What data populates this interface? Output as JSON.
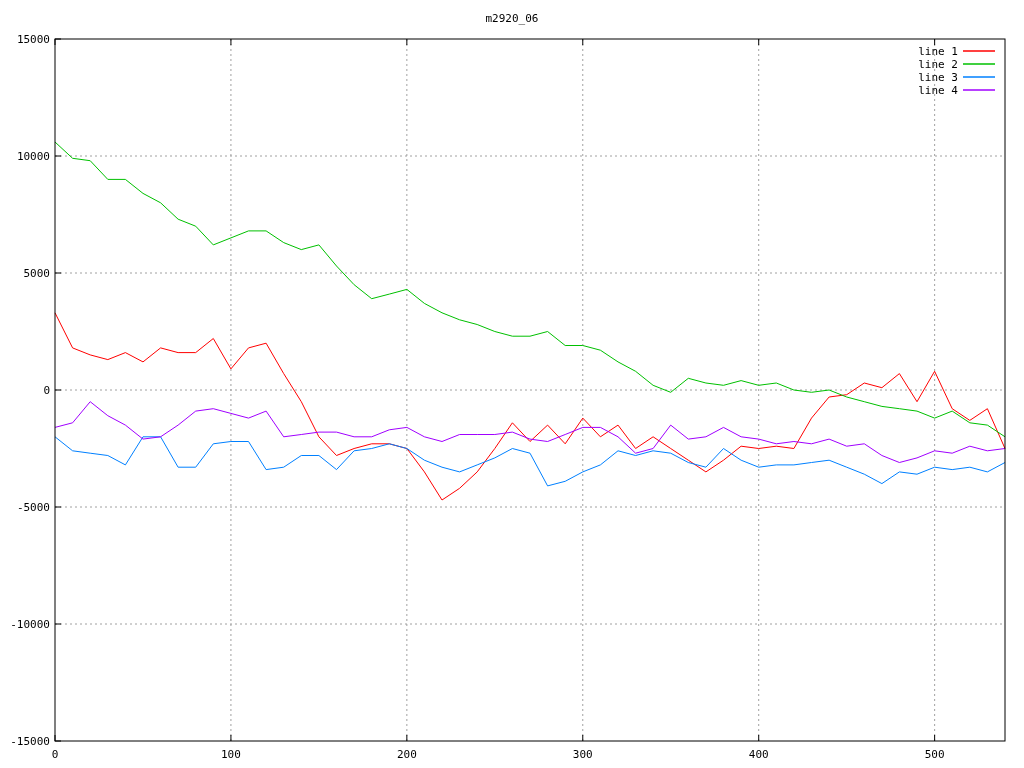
{
  "chart": {
    "chart_data": {
      "type": "line",
      "title": "m2920_06",
      "x": [
        0,
        10,
        20,
        30,
        40,
        50,
        60,
        70,
        80,
        90,
        100,
        110,
        120,
        130,
        140,
        150,
        160,
        170,
        180,
        190,
        200,
        210,
        220,
        230,
        240,
        250,
        260,
        270,
        280,
        290,
        300,
        310,
        320,
        330,
        340,
        350,
        360,
        370,
        380,
        390,
        400,
        410,
        420,
        430,
        440,
        450,
        460,
        470,
        480,
        490,
        500,
        510,
        520,
        530,
        540
      ],
      "series": [
        {
          "name": "line 1",
          "color": "#ff0000",
          "values": [
            3300,
            1800,
            1500,
            1300,
            1600,
            1200,
            1800,
            1600,
            1600,
            2200,
            900,
            1800,
            2000,
            700,
            -500,
            -2000,
            -2800,
            -2500,
            -2300,
            -2300,
            -2500,
            -3500,
            -4700,
            -4200,
            -3500,
            -2500,
            -1400,
            -2200,
            -1500,
            -2300,
            -1200,
            -2000,
            -1500,
            -2500,
            -2000,
            -2500,
            -3000,
            -3500,
            -3000,
            -2400,
            -2500,
            -2400,
            -2500,
            -1200,
            -300,
            -200,
            300,
            100,
            700,
            -500,
            800,
            -800,
            -1300,
            -800,
            -2500
          ]
        },
        {
          "name": "line 2",
          "color": "#00c000",
          "values": [
            10600,
            9900,
            9800,
            9000,
            9000,
            8400,
            8000,
            7300,
            7000,
            6200,
            6500,
            6800,
            6800,
            6300,
            6000,
            6200,
            5300,
            4500,
            3900,
            4100,
            4300,
            3700,
            3300,
            3000,
            2800,
            2500,
            2300,
            2300,
            2500,
            1900,
            1900,
            1700,
            1200,
            800,
            200,
            -100,
            500,
            300,
            200,
            400,
            200,
            300,
            0,
            -100,
            0,
            -300,
            -500,
            -700,
            -800,
            -900,
            -1200,
            -900,
            -1400,
            -1500,
            -2000
          ]
        },
        {
          "name": "line 3",
          "color": "#0080ff",
          "values": [
            -2000,
            -2600,
            -2700,
            -2800,
            -3200,
            -2000,
            -2000,
            -3300,
            -3300,
            -2300,
            -2200,
            -2200,
            -3400,
            -3300,
            -2800,
            -2800,
            -3400,
            -2600,
            -2500,
            -2300,
            -2500,
            -3000,
            -3300,
            -3500,
            -3200,
            -2900,
            -2500,
            -2700,
            -4100,
            -3900,
            -3500,
            -3200,
            -2600,
            -2800,
            -2600,
            -2700,
            -3100,
            -3300,
            -2500,
            -3000,
            -3300,
            -3200,
            -3200,
            -3100,
            -3000,
            -3300,
            -3600,
            -4000,
            -3500,
            -3600,
            -3300,
            -3400,
            -3300,
            -3500,
            -3100
          ]
        },
        {
          "name": "line 4",
          "color": "#a000ff",
          "values": [
            -1600,
            -1400,
            -500,
            -1100,
            -1500,
            -2100,
            -2000,
            -1500,
            -900,
            -800,
            -1000,
            -1200,
            -900,
            -2000,
            -1900,
            -1800,
            -1800,
            -2000,
            -2000,
            -1700,
            -1600,
            -2000,
            -2200,
            -1900,
            -1900,
            -1900,
            -1800,
            -2100,
            -2200,
            -1900,
            -1600,
            -1600,
            -2000,
            -2700,
            -2500,
            -1500,
            -2100,
            -2000,
            -1600,
            -2000,
            -2100,
            -2300,
            -2200,
            -2300,
            -2100,
            -2400,
            -2300,
            -2800,
            -3100,
            -2900,
            -2600,
            -2700,
            -2400,
            -2600,
            -2500
          ]
        }
      ],
      "grid": true,
      "legend": true,
      "xlim": [
        0,
        540
      ],
      "ylim": [
        -15000,
        15000
      ],
      "xticks": [
        0,
        100,
        200,
        300,
        400,
        500
      ],
      "yticks": [
        -15000,
        -10000,
        -5000,
        0,
        5000,
        10000,
        15000
      ]
    }
  }
}
